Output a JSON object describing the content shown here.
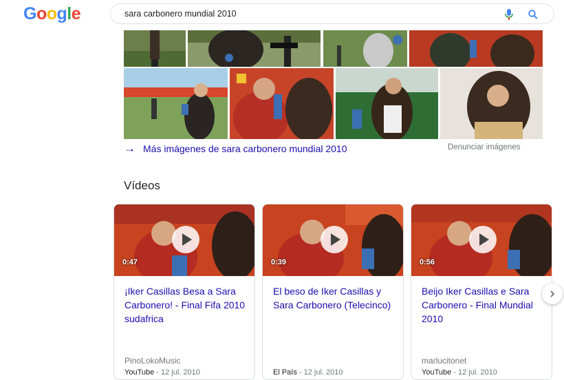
{
  "search": {
    "query": "sara carbonero mundial 2010"
  },
  "logo": {
    "text": "Google",
    "letters": [
      "G",
      "o",
      "o",
      "g",
      "l",
      "e"
    ],
    "colors": [
      "#4285f4",
      "#ea4335",
      "#fbbc05",
      "#4285f4",
      "#34a853",
      "#ea4335"
    ]
  },
  "images": {
    "more_link": "Más imágenes de sara carbonero mundial 2010",
    "report": "Denunciar imágenes"
  },
  "videos": {
    "title": "Vídeos",
    "items": [
      {
        "duration": "0:47",
        "title": "¡Iker Casillas Besa a Sara Carbonero! - Final Fifa 2010 sudafrica",
        "channel": "PinoLokoMusic",
        "source": "YouTube",
        "date": " - 12 jul. 2010"
      },
      {
        "duration": "0:39",
        "title": "El beso de Iker Casillas y Sara Carbonero (Telecinco)",
        "channel": "",
        "source": "El País",
        "date": " - 12 jul. 2010"
      },
      {
        "duration": "0:56",
        "title": "Beijo Iker Casillas e Sara Carbonero - Final Mundial 2010",
        "channel": "marlucitonet",
        "source": "YouTube",
        "date": " - 12 jul. 2010"
      }
    ]
  },
  "colors": {
    "link": "#1a0dab",
    "muted": "#70757a",
    "border": "#dadce0"
  }
}
